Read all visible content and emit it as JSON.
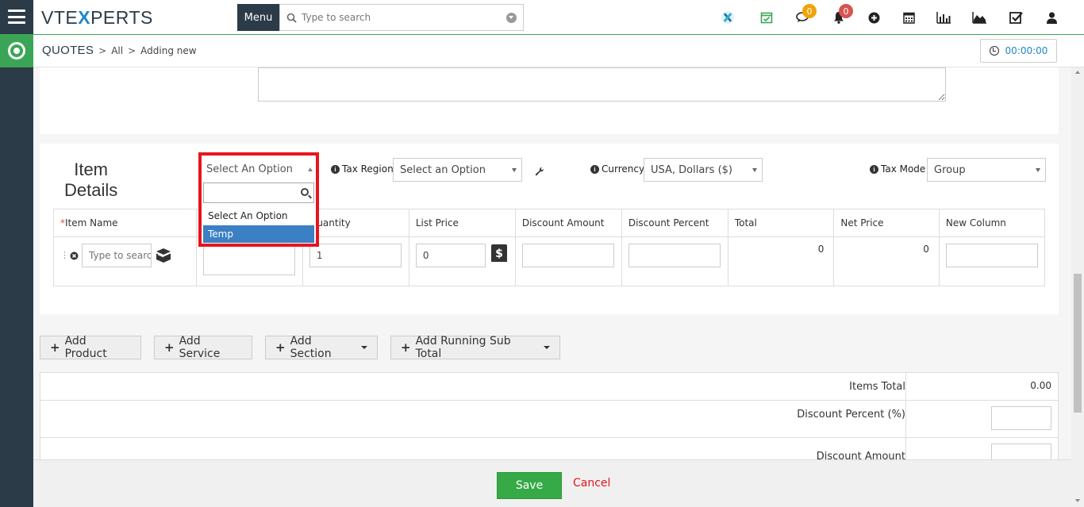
{
  "app": {
    "logo_left": "VTE",
    "logo_x": "X",
    "logo_right": "PERTS"
  },
  "topbar": {
    "menu_label": "Menu",
    "search_placeholder": "Type to search",
    "icons": [
      "vtiger-x-icon",
      "calendar-check-icon",
      "chat-icon",
      "bell-icon",
      "plus-circle-icon",
      "calendar-icon",
      "bar-chart-icon",
      "area-chart-icon",
      "task-check-icon",
      "user-icon"
    ],
    "chat_badge": "0",
    "bell_badge": "0"
  },
  "breadcrumb": {
    "module": "QUOTES",
    "filter": "All",
    "action": "Adding new"
  },
  "timer": {
    "value": "00:00:00"
  },
  "item_details": {
    "title_line1": "Item",
    "title_line2": "Details",
    "section_select": "Select An Option",
    "tax_region_label": "Tax Region",
    "tax_region_value": "Select an Option",
    "currency_label": "Currency",
    "currency_value": "USA, Dollars ($)",
    "tax_mode_label": "Tax Mode",
    "tax_mode_value": "Group"
  },
  "table": {
    "columns": [
      "Item Name",
      "",
      "Quantity",
      "List Price",
      "Discount Amount",
      "Discount Percent",
      "Total",
      "Net Price",
      "New Column"
    ],
    "row": {
      "item_name_placeholder": "Type to search",
      "quantity": "1",
      "list_price": "0",
      "total": "0",
      "net_price": "0"
    }
  },
  "dropdown": {
    "header": "Select An Option",
    "options": [
      "Select An Option",
      "Temp"
    ],
    "selected_index": 1
  },
  "buttons": {
    "add_product": "Add Product",
    "add_service": "Add Service",
    "add_section": "Add Section",
    "add_running_sub_total": "Add Running Sub Total"
  },
  "totals": {
    "items_total_label": "Items Total",
    "items_total_value": "0.00",
    "discount_percent_label": "Discount Percent (%)",
    "discount_amount_label": "Discount Amount"
  },
  "footer": {
    "save": "Save",
    "cancel": "Cancel"
  },
  "colors": {
    "accent": "#3aa655",
    "rail": "#2c3b48",
    "highlight": "#e8141c",
    "selected": "#3b7fc4"
  }
}
